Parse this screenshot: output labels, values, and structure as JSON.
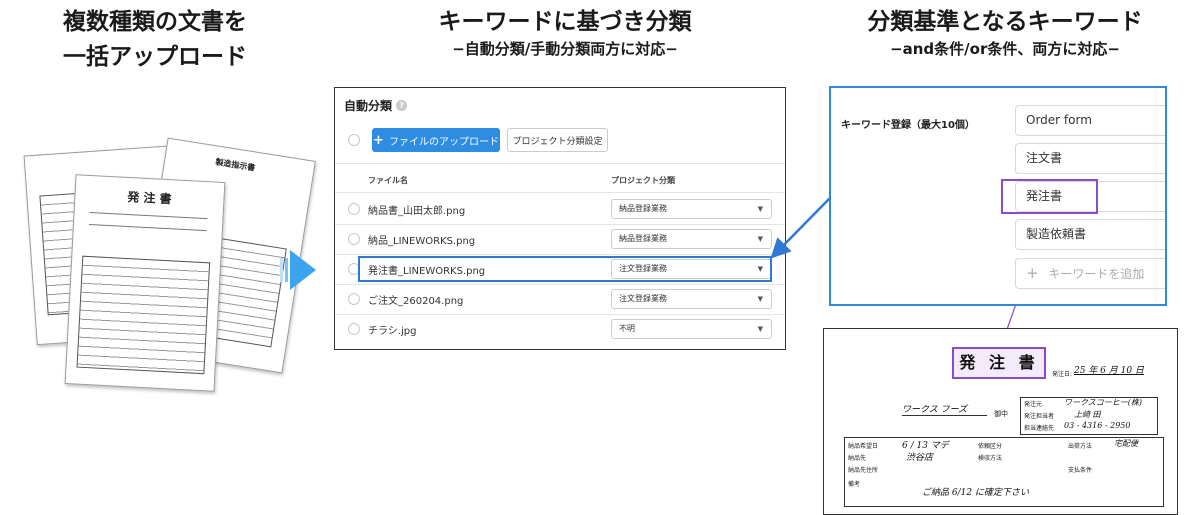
{
  "headings": {
    "left": {
      "line1": "複数種類の文書を",
      "line2": "一括アップロード"
    },
    "center": {
      "main": "キーワードに基づき分類",
      "sub": "−自動分類/手動分類両方に対応−"
    },
    "right": {
      "main": "分類基準となるキーワード",
      "sub": "−and条件/or条件、両方に対応−"
    }
  },
  "documents": {
    "front_title": "発 注 書",
    "middle_title": "製造指示書"
  },
  "app": {
    "title": "自動分類",
    "upload_button": "ファイルのアップロード",
    "project_button": "プロジェクト分類設定",
    "columns": {
      "file": "ファイル名",
      "project": "プロジェクト分類"
    },
    "rows": [
      {
        "file": "納品書_山田太郎.png",
        "project": "納品登録業務"
      },
      {
        "file": "納品_LINEWORKS.png",
        "project": "納品登録業務"
      },
      {
        "file": "発注書_LINEWORKS.png",
        "project": "注文登録業務"
      },
      {
        "file": "ご注文_260204.png",
        "project": "注文登録業務"
      },
      {
        "file": "チラシ.jpg",
        "project": "不明"
      }
    ]
  },
  "keywords": {
    "label": "キーワード登録（最大10個）",
    "items": [
      "Order form",
      "注文書",
      "発注書",
      "製造依頼書"
    ],
    "add_placeholder": "キーワードを追加"
  },
  "scanned_form": {
    "title": "発 注 書",
    "date_label": "発注日:",
    "date_value": "25 年 6 月 10 日",
    "recipient": "ワークス フーズ",
    "recipient_suffix": "御中",
    "issuer_labels": [
      "発注元",
      "発注担当者",
      "担当連絡先"
    ],
    "issuer_values": [
      "ワークスコーヒー(株)",
      "上崎 田",
      "03 - 4316 - 2950"
    ],
    "row_labels": [
      "納品希望日",
      "納品先",
      "納品先住所",
      "備考"
    ],
    "row_values": [
      "6 / 13 マデ",
      "渋谷店",
      "",
      "ご納品 6/12 に確定下さい"
    ],
    "mid_labels": [
      "依頼区分",
      "検収方法"
    ],
    "right_labels": [
      "出荷方法",
      "支払条件"
    ],
    "right_values": [
      "宅配便"
    ]
  },
  "colors": {
    "accent_blue": "#2c8de3",
    "highlight_blue": "#2f78d4",
    "highlight_purple": "#8a4cc8",
    "arrow_blue": "#3ea3ee"
  }
}
